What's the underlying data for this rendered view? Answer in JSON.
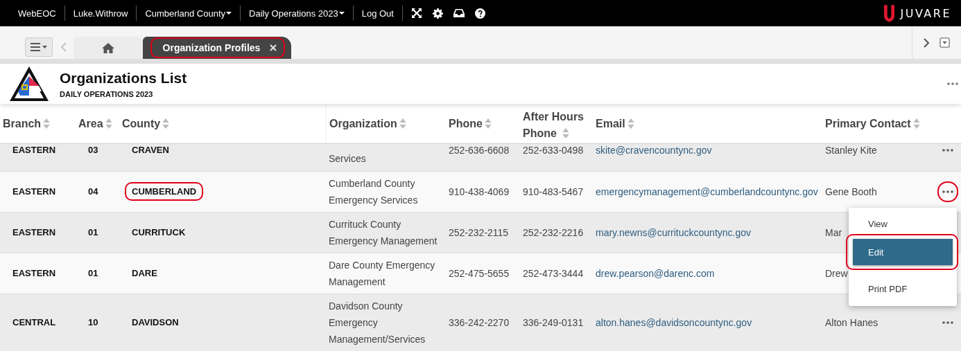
{
  "top_bar": {
    "items": [
      {
        "label": "WebEOC",
        "dropdown": false
      },
      {
        "label": "Luke.Withrow",
        "dropdown": false
      },
      {
        "label": "Cumberland County",
        "dropdown": true
      },
      {
        "label": "Daily Operations 2023",
        "dropdown": true
      },
      {
        "label": "Log Out",
        "dropdown": false
      }
    ],
    "logo": "JUVARE"
  },
  "tabs": [
    {
      "kind": "home",
      "selected": false,
      "highlighted": false
    },
    {
      "kind": "page",
      "label": "Organization Profiles",
      "selected": true,
      "highlighted": true
    }
  ],
  "page": {
    "title": "Organizations List",
    "subtitle": "DAILY OPERATIONS 2023"
  },
  "table": {
    "columns": [
      {
        "label": "Branch"
      },
      {
        "label": "Area"
      },
      {
        "label": "County"
      },
      {
        "label": "Organization"
      },
      {
        "label": "Phone"
      },
      {
        "label": "After Hours Phone"
      },
      {
        "label": "Email"
      },
      {
        "label": "Primary Contact"
      }
    ],
    "rows": [
      {
        "branch": "EASTERN",
        "area": "03",
        "county": "CRAVEN",
        "county_highlighted": false,
        "organization": "Services",
        "phone": "252-636-6608",
        "after_hours_phone": "252-633-0498",
        "email": "skite@cravencountync.gov",
        "primary_contact": "Stanley Kite",
        "actions_highlighted": false
      },
      {
        "branch": "EASTERN",
        "area": "04",
        "county": "CUMBERLAND",
        "county_highlighted": true,
        "organization": "Cumberland County Emergency Services",
        "phone": "910-438-4069",
        "after_hours_phone": "910-483-5467",
        "email": "emergencymanagement@cumberlandcountync.gov",
        "primary_contact": "Gene Booth",
        "actions_highlighted": true,
        "menu": {
          "items": [
            {
              "label": "View",
              "selected": false,
              "highlighted": false
            },
            {
              "label": "Edit",
              "selected": true,
              "highlighted": true
            },
            {
              "label": "Print PDF",
              "selected": false,
              "highlighted": false
            }
          ]
        }
      },
      {
        "branch": "EASTERN",
        "area": "01",
        "county": "CURRITUCK",
        "county_highlighted": false,
        "organization": "Currituck County Emergency Management",
        "phone": "252-232-2115",
        "after_hours_phone": "252-232-2216",
        "email": "mary.newns@currituckcountync.gov",
        "primary_contact": "Mar"
      },
      {
        "branch": "EASTERN",
        "area": "01",
        "county": "DARE",
        "county_highlighted": false,
        "organization": "Dare County Emergency Management",
        "phone": "252-475-5655",
        "after_hours_phone": "252-473-3444",
        "email": "drew.pearson@darenc.com",
        "primary_contact": "Drew"
      },
      {
        "branch": "CENTRAL",
        "area": "10",
        "county": "DAVIDSON",
        "county_highlighted": false,
        "organization": "Davidson County Emergency Management/Services",
        "phone": "336-242-2270",
        "after_hours_phone": "336-249-0131",
        "email": "alton.hanes@davidsoncountync.gov",
        "primary_contact": "Alton Hanes",
        "actions_highlighted": false
      }
    ]
  }
}
